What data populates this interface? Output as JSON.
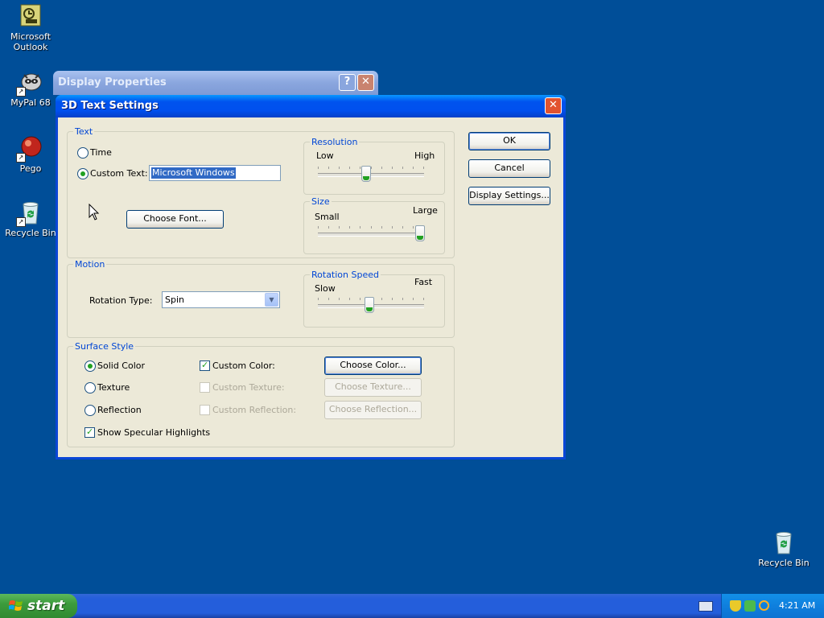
{
  "desktop": {
    "icons": [
      {
        "label_line1": "Microsoft",
        "label_line2": "Outlook",
        "icon": "outlook-icon"
      },
      {
        "label_line1": "MyPal 68",
        "icon": "mypal-icon"
      },
      {
        "label_line1": "Pego",
        "icon": "pego-icon"
      },
      {
        "label_line1": "Recycle Bin",
        "icon": "recycle-bin-icon"
      },
      {
        "label_line1": "Recycle Bin",
        "icon": "recycle-bin-icon"
      }
    ]
  },
  "background_window": {
    "title": "Display Properties",
    "help_glyph": "?",
    "close_glyph": "✕"
  },
  "dialog": {
    "title": "3D Text Settings",
    "close_glyph": "✕",
    "text_group": {
      "label": "Text",
      "time_label": "Time",
      "custom_text_label": "Custom Text:",
      "custom_text_value": "Microsoft Windows",
      "choose_font_label": "Choose Font...",
      "selected_option": "Custom Text"
    },
    "resolution": {
      "label": "Resolution",
      "low": "Low",
      "high": "High",
      "value_fraction": 0.45
    },
    "size": {
      "label": "Size",
      "small": "Small",
      "large": "Large",
      "value_fraction": 1.0
    },
    "motion_group": {
      "label": "Motion",
      "rotation_type_label": "Rotation Type:",
      "rotation_type_value": "Spin"
    },
    "rotation_speed": {
      "label": "Rotation Speed",
      "slow": "Slow",
      "fast": "Fast",
      "value_fraction": 0.48
    },
    "surface_group": {
      "label": "Surface Style",
      "solid_color": "Solid Color",
      "texture": "Texture",
      "reflection": "Reflection",
      "custom_color": "Custom Color:",
      "custom_texture": "Custom Texture:",
      "custom_reflection": "Custom Reflection:",
      "choose_color": "Choose Color...",
      "choose_texture": "Choose Texture...",
      "choose_reflection": "Choose Reflection...",
      "show_specular": "Show Specular Highlights",
      "selected_style": "Solid Color",
      "custom_color_checked": true,
      "show_specular_checked": true
    },
    "buttons": {
      "ok": "OK",
      "cancel": "Cancel",
      "display_settings": "Display Settings..."
    }
  },
  "taskbar": {
    "start_label": "start",
    "clock": "4:21 AM"
  },
  "colors": {
    "desktop": "#004e98",
    "title_active": "#0053ee",
    "dialog_face": "#ece9d8",
    "group_label": "#0046d5",
    "check_green": "#21a121"
  }
}
